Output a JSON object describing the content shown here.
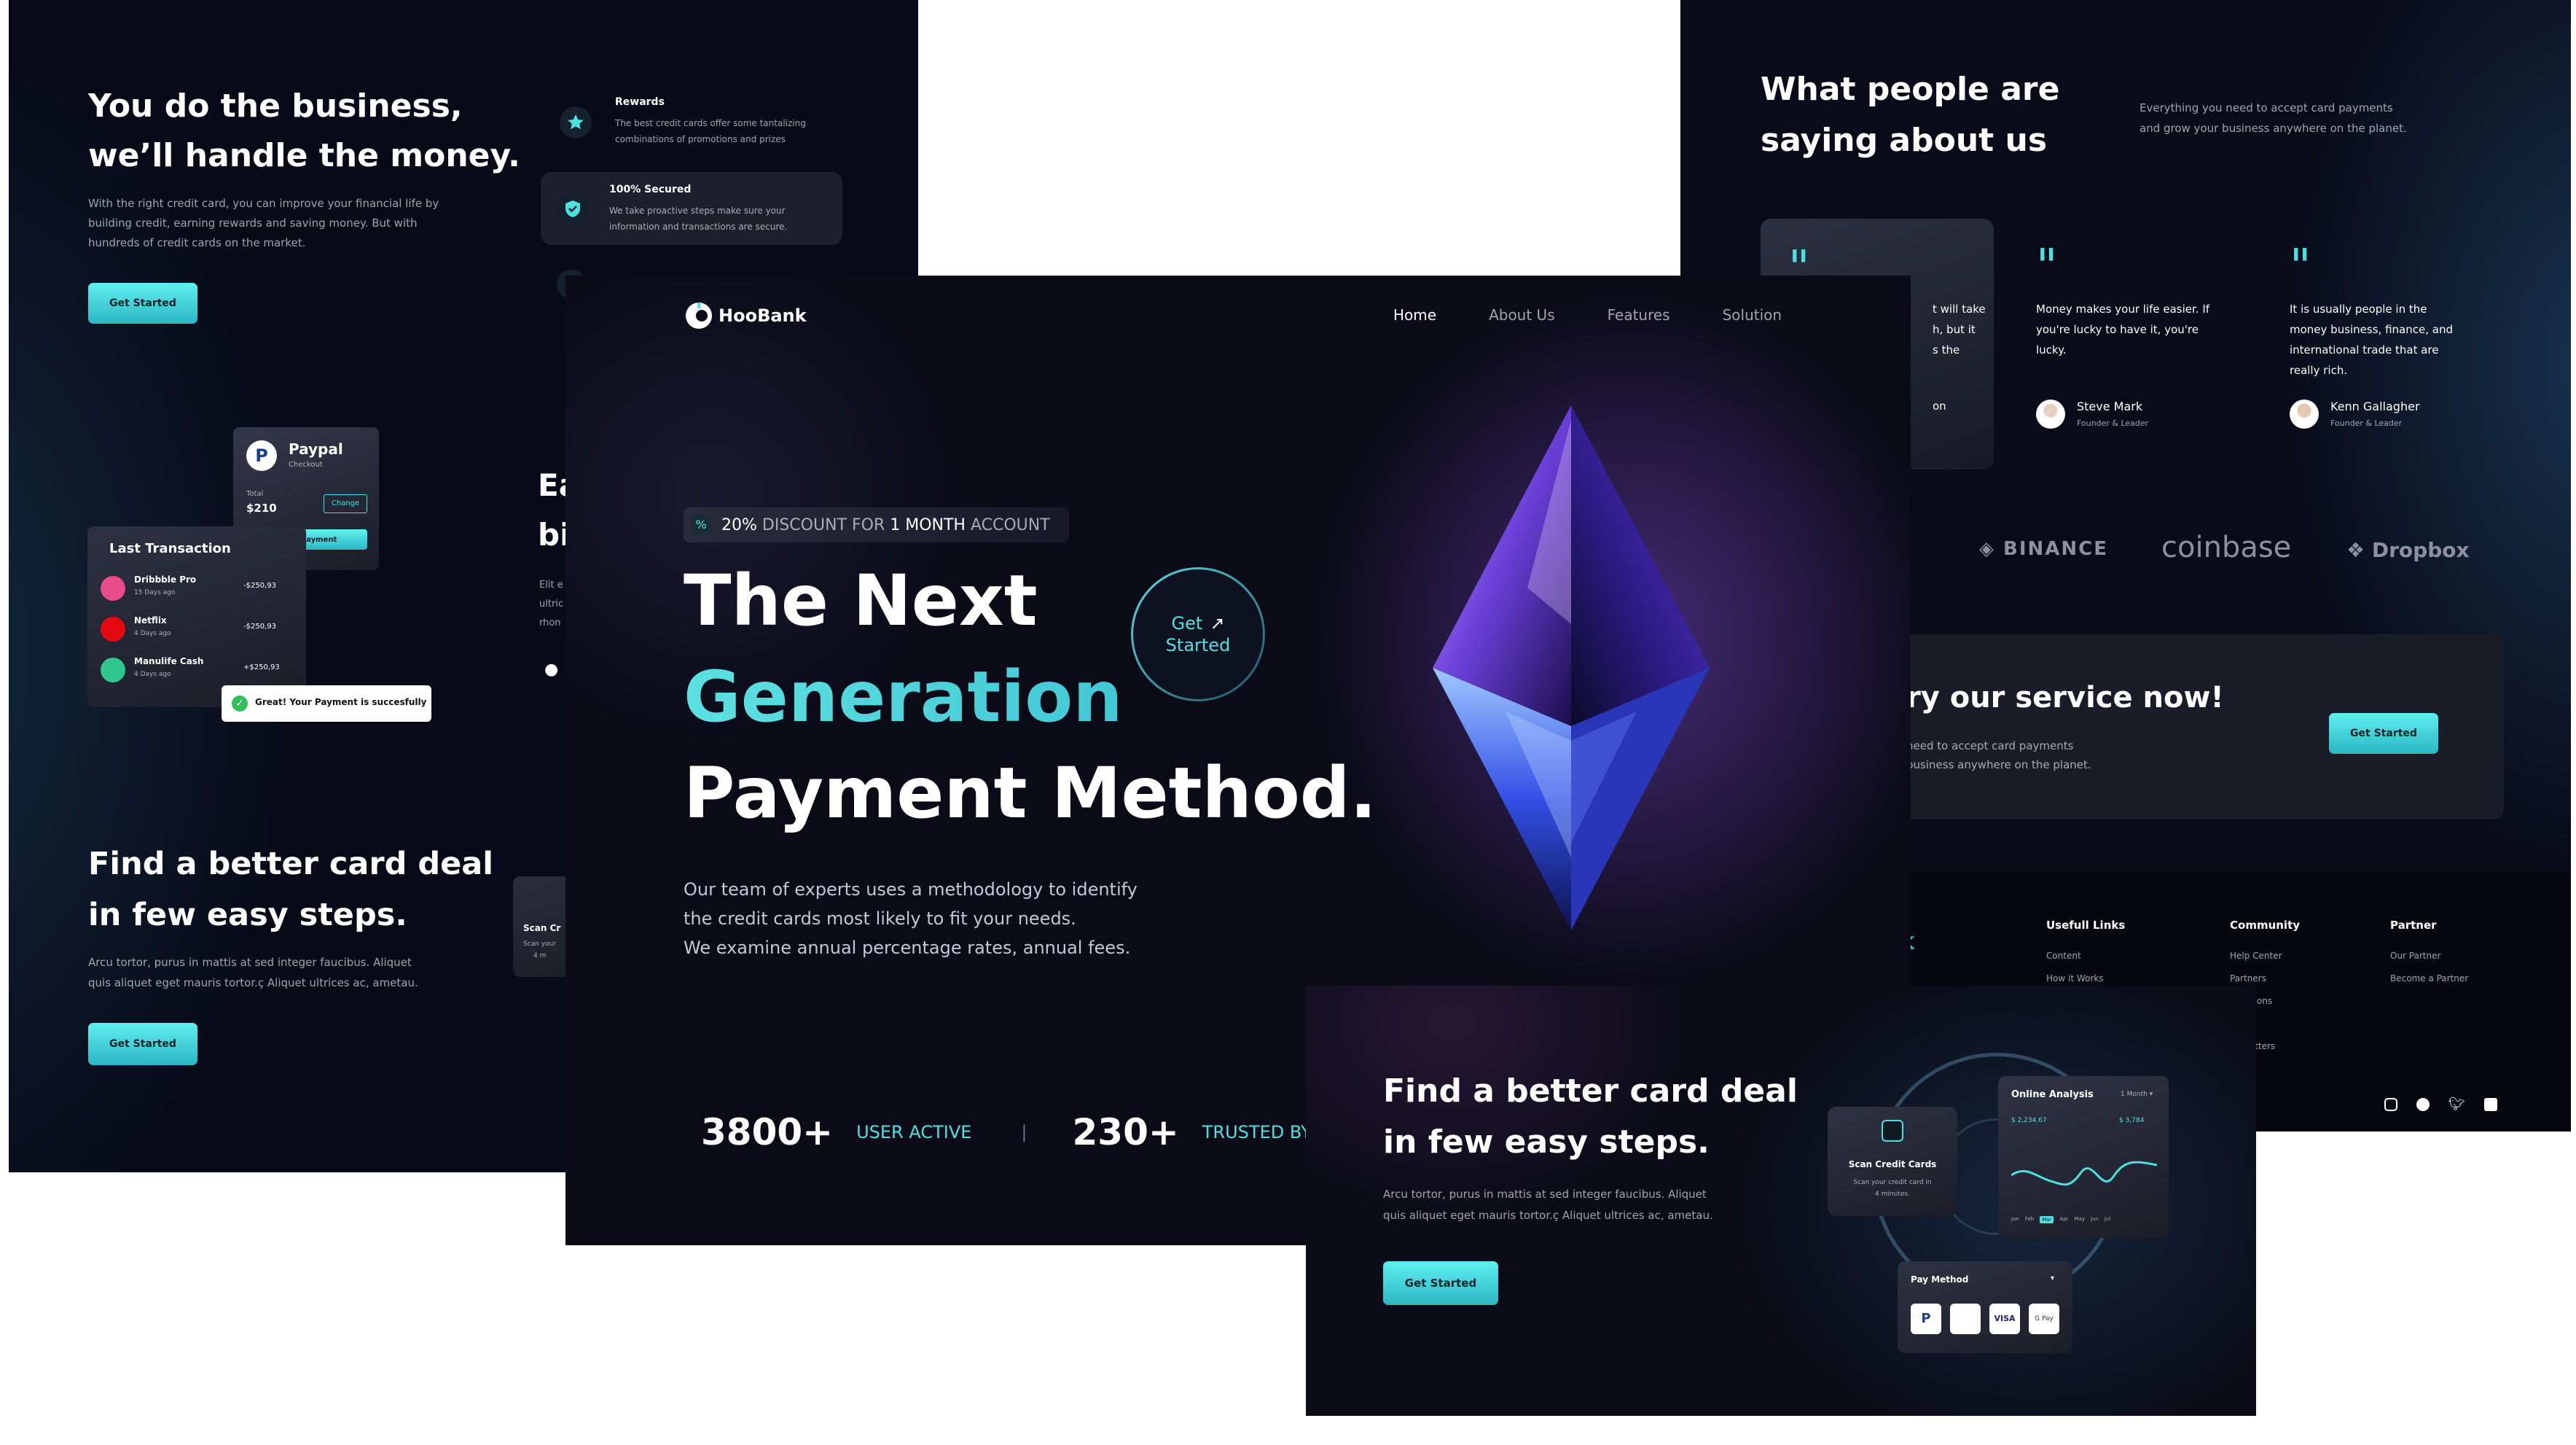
{
  "left_panel": {
    "hero": {
      "title_l1": "You do the business,",
      "title_l2": "we’ll handle the money.",
      "desc_l1": "With the right credit card, you can improve your financial life by",
      "desc_l2": "building credit, earning rewards and saving money. But with",
      "desc_l3": "hundreds of credit cards on the market.",
      "cta": "Get Started"
    },
    "features": [
      {
        "title": "Rewards",
        "desc_l1": "The best credit cards offer some tantalizing",
        "desc_l2": "combinations of promotions and prizes",
        "icon": "star-icon"
      },
      {
        "title": "100% Secured",
        "desc_l1": "We take proactive steps make sure your",
        "desc_l2": "information and transactions are secure.",
        "icon": "shield-icon"
      }
    ],
    "paypal_card": {
      "title": "Paypal",
      "subtitle": "Checkout",
      "total_label": "Total",
      "amount": "$210",
      "change": "Change",
      "pay_button": "Make Payment"
    },
    "transactions": {
      "title": "Last Transaction",
      "items": [
        {
          "name": "Dribbble Pro",
          "when": "15 Days ago",
          "amount": "-$250,93",
          "color": "#ea4c89"
        },
        {
          "name": "Netflix",
          "when": "4 Days ago",
          "amount": "-$250,93",
          "color": "#e50914"
        },
        {
          "name": "Manulife Cash",
          "when": "4 Days ago",
          "amount": "+$250,93",
          "color": "#2fc88f"
        }
      ]
    },
    "toast": "Great! Your Payment is succesfully",
    "partial_heading_l1": "Ea",
    "partial_heading_l2": "bi",
    "partial_text_l1": "Elit e",
    "partial_text_l2": "ultric",
    "partial_text_l3": "rhon",
    "scan_partial_title": "Scan Cr",
    "scan_partial_sub1": "Scan your",
    "scan_partial_sub2": "4 m",
    "steps": {
      "title_l1": "Find a better card deal",
      "title_l2": "in few easy steps.",
      "desc_l1": "Arcu tortor, purus in mattis at sed integer faucibus. Aliquet",
      "desc_l2": "quis aliquet eget mauris tortor.ç Aliquet ultrices ac, ametau.",
      "cta": "Get Started"
    }
  },
  "right_panel": {
    "title_l1": "What people are",
    "title_l2": "saying about us",
    "desc_l1": "Everything you need to accept card payments",
    "desc_l2": "and grow your business anywhere on the planet.",
    "testimonials": [
      {
        "text_l1": "t will take",
        "text_l2": "h, but it",
        "text_l3": "s the",
        "name": "on",
        "role": ""
      },
      {
        "text_l1": "Money makes your life easier. If",
        "text_l2": "you're lucky to have it, you're",
        "text_l3": "lucky.",
        "text_l4": "",
        "name": "Steve Mark",
        "role": "Founder & Leader"
      },
      {
        "text_l1": "It is usually people in the",
        "text_l2": "money business, finance, and",
        "text_l3": "international trade that are",
        "text_l4": "really rich.",
        "name": "Kenn Gallagher",
        "role": "Founder & Leader"
      }
    ],
    "logos": [
      "BINANCE",
      "coinbase",
      "Dropbox"
    ],
    "cta_block": {
      "title": "ry our service now!",
      "desc_l1": "need to accept card payments",
      "desc_l2": "business anywhere on the planet.",
      "button": "Get Started"
    },
    "footer": {
      "brand_partial": "k",
      "columns": [
        {
          "title": "Usefull Links",
          "items": [
            "Content",
            "How it Works"
          ]
        },
        {
          "title": "Community",
          "items": [
            "Help Center",
            "Partners",
            "ggestions",
            "og",
            "ewsletters"
          ]
        },
        {
          "title": "Partner",
          "items": [
            "Our Partner",
            "Become a Partner"
          ]
        }
      ]
    }
  },
  "center_panel": {
    "brand": "HooBank",
    "nav": [
      "Home",
      "About Us",
      "Features",
      "Solution"
    ],
    "badge_value": "20%",
    "badge_text1": "DISCOUNT FOR",
    "badge_value2": "1 MONTH",
    "badge_text2": "ACCOUNT",
    "title_l1": "The Next",
    "title_l2": "Generation",
    "title_l3": "Payment Method.",
    "get_started_l1": "Get",
    "get_started_l2": "Started",
    "desc_l1": "Our team of experts uses a methodology to identify",
    "desc_l2": "the credit cards most likely to fit your needs.",
    "desc_l3": "We examine annual percentage rates, annual fees.",
    "stats": [
      {
        "value": "3800+",
        "label": "USER ACTIVE"
      },
      {
        "value": "230+",
        "label": "TRUSTED BY C"
      }
    ],
    "divider": "|"
  },
  "bottom_panel": {
    "title_l1": "Find a better card deal",
    "title_l2": "in few easy steps.",
    "desc_l1": "Arcu tortor, purus in mattis at sed integer faucibus. Aliquet",
    "desc_l2": "quis aliquet eget mauris tortor.ç Aliquet ultrices ac, ametau.",
    "cta": "Get Started",
    "scan_card": {
      "title": "Scan Credit Cards",
      "sub_l1": "Scan your credit card in",
      "sub_l2": "4 minutes."
    },
    "analysis": {
      "title": "Online Analysis",
      "period": "1 Month",
      "v1": "$ 2,234.67",
      "v2": "$ 3,784",
      "months": [
        "Jan",
        "Feb",
        "Mar",
        "Apr",
        "May",
        "Jun",
        "Jul"
      ]
    },
    "pay_method": {
      "title": "Pay Method"
    },
    "pay_icons": [
      "P",
      "",
      "VISA",
      "G Pay"
    ]
  }
}
